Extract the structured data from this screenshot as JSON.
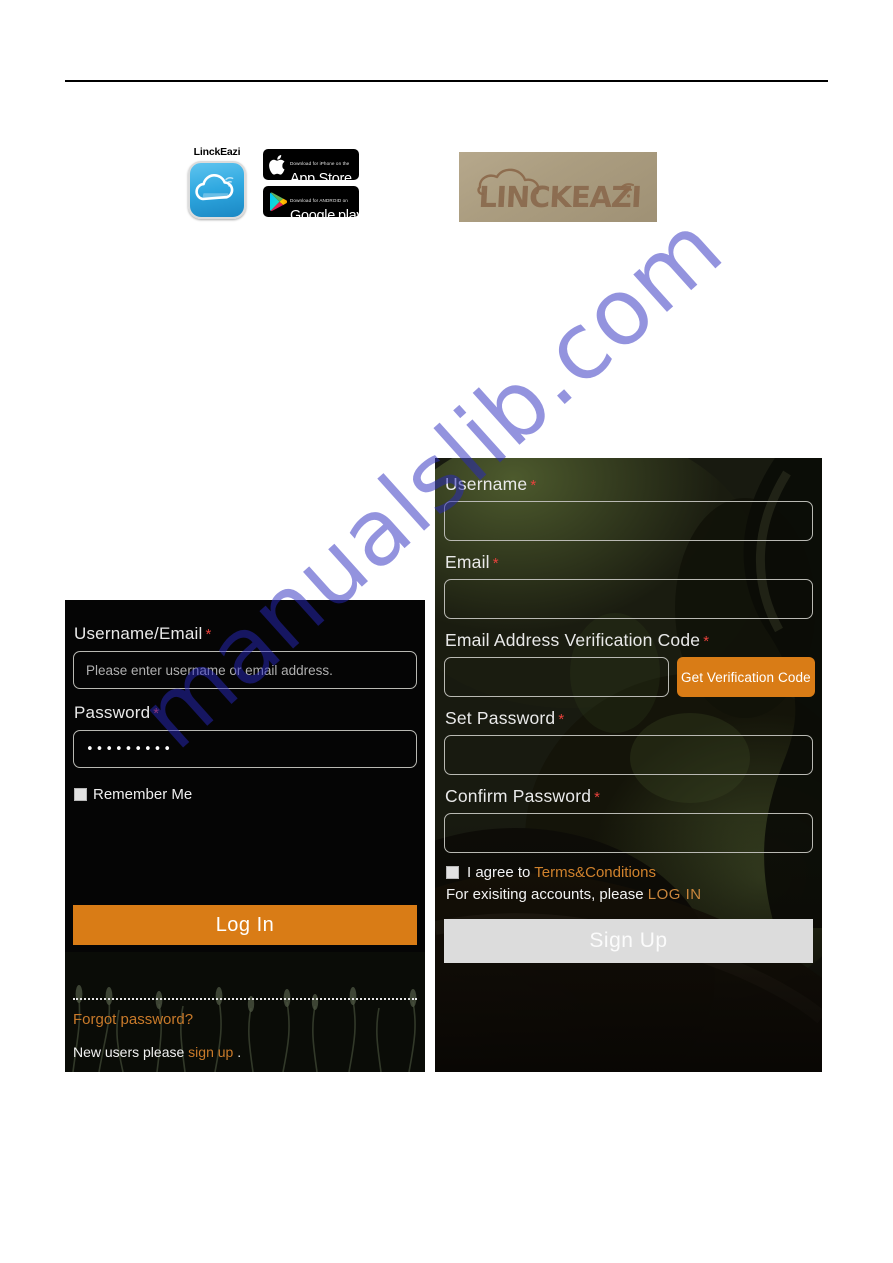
{
  "promo": {
    "app_icon_label": "LinckEazi",
    "app_icon_name": "linckeazi-cloud-app-icon",
    "app_store": {
      "small_text": "Download for iPhone on the",
      "big_text": "App Store",
      "icon": "apple-logo-icon"
    },
    "google_play": {
      "small_text": "Download for ANDROID on",
      "big_text_1": "Google",
      "big_text_2": "play",
      "icon": "google-play-triangle-icon"
    },
    "logo_plate": {
      "wordmark": "LINCKEAZI",
      "icons": [
        "cloud-outline-icon",
        "wifi-signal-icon"
      ],
      "background_color": "#ab9d80",
      "wordmark_color": "#8a6a4e"
    }
  },
  "watermark": {
    "text": "manualslib.com",
    "color": "#2828be"
  },
  "login": {
    "username": {
      "label": "Username/Email",
      "required_marker": "*",
      "placeholder": "Please enter username or email address.",
      "value": ""
    },
    "password": {
      "label": "Password",
      "required_marker": "*",
      "value": "•••••••••",
      "placeholder": ""
    },
    "remember_me": {
      "label": "Remember Me",
      "checked": false
    },
    "login_button": "Log    In",
    "forgot_password": "Forgot password?",
    "new_users_prefix": "New users please ",
    "new_users_link": "sign up",
    "new_users_suffix": " ."
  },
  "signup": {
    "username": {
      "label": "Username",
      "required_marker": "*",
      "value": ""
    },
    "email": {
      "label": "Email",
      "required_marker": "*",
      "value": ""
    },
    "verification_code": {
      "label": "Email Address Verification Code",
      "required_marker": "*",
      "value": "",
      "button": "Get Verification Code"
    },
    "set_password": {
      "label": "Set Password",
      "required_marker": "*",
      "value": ""
    },
    "confirm_password": {
      "label": "Confirm Password",
      "required_marker": "*",
      "value": ""
    },
    "agree": {
      "prefix": "I agree to ",
      "link": "Terms&Conditions",
      "checked": false
    },
    "existing_prefix": "For exisiting accounts, please ",
    "existing_link": "LOG IN",
    "signup_button": "Sign    Up"
  },
  "colors": {
    "accent_orange": "#d97c16",
    "required_red": "#e8423c",
    "link_orange": "#c97a2a",
    "disabled_gray": "#dcdcdc"
  }
}
